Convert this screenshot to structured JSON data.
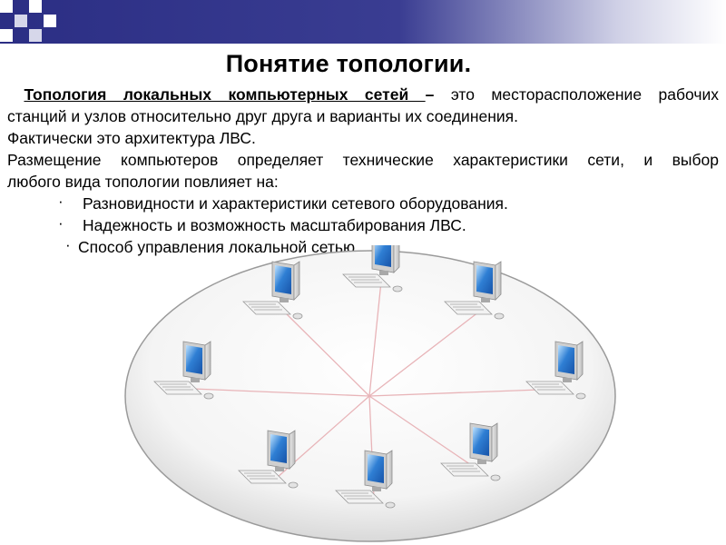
{
  "slide": {
    "title": "Понятие топологии.",
    "paragraph1": {
      "term": "Топология локальных компьютерных сетей ",
      "dash": "–",
      "line1_rest": " это месторасположение рабочих",
      "line2": "станций и узлов относительно друг друга и варианты их соединения."
    },
    "paragraph2": "Фактически это архитектура ЛВС.",
    "paragraph3": {
      "line1": " Размещение компьютеров определяет технические характеристики сети, и выбор",
      "line2": "любого вида топологии повлияет на:"
    },
    "bullet_marker": "·",
    "bullets": [
      "Разновидности и характеристики сетевого оборудования.",
      "Надежность и возможность масштабирования ЛВС.",
      "Способ управления локальной сетью."
    ]
  },
  "diagram": {
    "topology": "star",
    "node_count": 8,
    "node_icon": "desktop-computer-icon",
    "link_color": "#e8b4b8",
    "monitor_color": "#2f7fd4"
  }
}
